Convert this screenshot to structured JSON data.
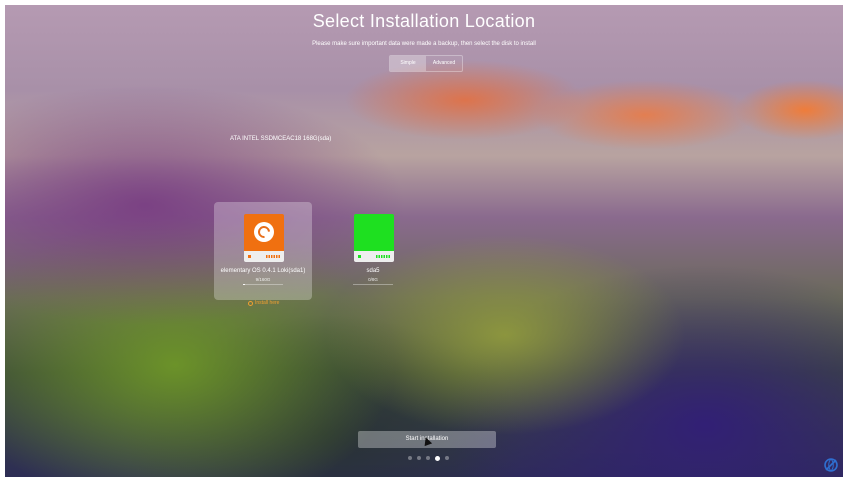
{
  "header": {
    "title": "Select Installation Location",
    "subtitle": "Please make sure important data were made a backup, then select the disk to install"
  },
  "mode_tabs": [
    {
      "label": "Simple",
      "active": true
    },
    {
      "label": "Advanced",
      "active": false
    }
  ],
  "disk": {
    "label": "ATA INTEL SSDMCEAC18 168G(sda)"
  },
  "partitions": [
    {
      "name": "elementary OS 0.4.1 Loki(sda1)",
      "size": "9/160G",
      "usage": 0.06,
      "color": "#f07010",
      "selected": true
    },
    {
      "name": "sda5",
      "size": "0/8G",
      "usage": 0,
      "color": "#1ee020",
      "selected": false
    }
  ],
  "install_hint": "Install here",
  "actions": {
    "start_label": "Start installation"
  },
  "pager": {
    "total": 5,
    "current": 4
  },
  "colors": {
    "accent": "#f0a030",
    "drive_orange": "#f07010",
    "drive_green": "#1ee020"
  },
  "icons": {
    "corner": "network-icon",
    "distro_logo": "deepin-logo-icon",
    "hint": "info-icon"
  }
}
